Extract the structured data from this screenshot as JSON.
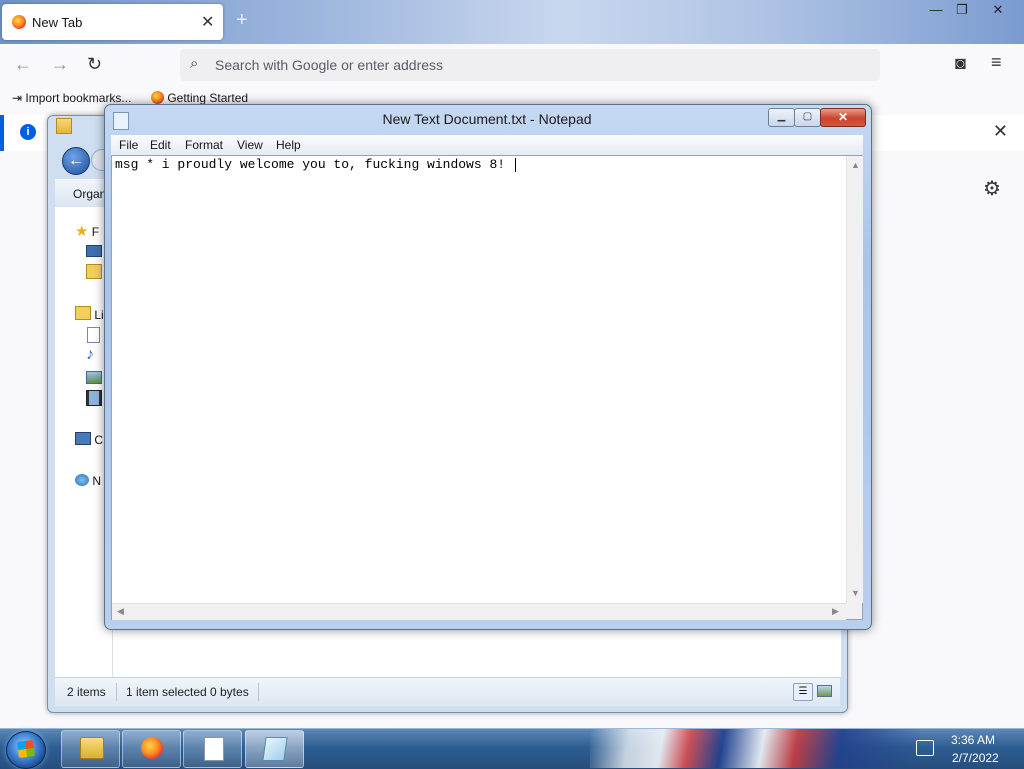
{
  "firefox": {
    "tab_title": "New Tab",
    "tab_close": "✕",
    "new_tab": "+",
    "window_controls": {
      "minimize": "—",
      "restore": "❐",
      "close": "✕"
    },
    "nav": {
      "back": "←",
      "forward": "→",
      "reload": "↻"
    },
    "url_placeholder": "Search with Google or enter address",
    "toolbar": {
      "pocket": "◙",
      "menu": "≡"
    },
    "bookmarks": [
      {
        "label": "Import bookmarks...",
        "icon": "import-icon"
      },
      {
        "label": "Getting Started",
        "icon": "firefox-icon"
      }
    ],
    "info_bar": {
      "icon": "i",
      "close": "✕"
    },
    "settings_icon": "⚙"
  },
  "explorer": {
    "organize_label": "Organ",
    "nav_items": [
      {
        "label": "F",
        "icon": "star-icon"
      },
      {
        "label": "",
        "icon": "desktop-icon"
      },
      {
        "label": "",
        "icon": "downloads-icon"
      },
      {
        "label": "Li",
        "icon": "libraries-icon"
      },
      {
        "label": "",
        "icon": "documents-icon"
      },
      {
        "label": "",
        "icon": "music-icon"
      },
      {
        "label": "",
        "icon": "pictures-icon"
      },
      {
        "label": "",
        "icon": "videos-icon"
      },
      {
        "label": "C",
        "icon": "computer-icon"
      },
      {
        "label": "N",
        "icon": "network-icon"
      }
    ],
    "status": {
      "items": "2 items",
      "selected": "1 item selected",
      "size": "0 bytes"
    }
  },
  "notepad": {
    "title": "New Text Document.txt - Notepad",
    "menu": [
      "File",
      "Edit",
      "Format",
      "View",
      "Help"
    ],
    "content": "msg * i proudly welcome you to, fucking windows 8!",
    "controls": {
      "minimize": "▁",
      "maximize": "▢",
      "close": "✕"
    }
  },
  "taskbar": {
    "buttons": [
      {
        "name": "explorer",
        "icon": "folder-icon"
      },
      {
        "name": "firefox",
        "icon": "firefox-icon"
      },
      {
        "name": "document",
        "icon": "document-icon"
      },
      {
        "name": "notepad",
        "icon": "notepad-icon"
      }
    ],
    "clock_time": "3:36 AM",
    "clock_date": "2/7/2022"
  },
  "colors": {
    "accent": "#0060df",
    "close_red": "#c9452b",
    "taskbar": "#2e5e93"
  }
}
